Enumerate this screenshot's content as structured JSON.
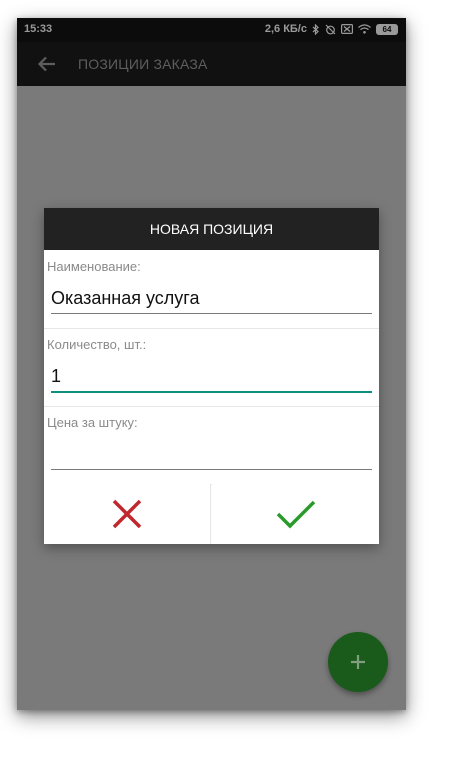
{
  "status_bar": {
    "time": "15:33",
    "speed": "2,6 КБ/с",
    "battery": "64"
  },
  "toolbar": {
    "title": "ПОЗИЦИИ ЗАКАЗА"
  },
  "dialog": {
    "title": "НОВАЯ ПОЗИЦИЯ",
    "fields": [
      {
        "label": "Наименование:",
        "value": "Оказанная услуга"
      },
      {
        "label": "Количество, шт.:",
        "value": "1"
      },
      {
        "label": "Цена за штуку:",
        "value": ""
      }
    ]
  },
  "colors": {
    "accent": "#0e8f7e",
    "cancel": "#c0282d",
    "confirm": "#2a9a2a",
    "fab": "#1a5a1a"
  }
}
